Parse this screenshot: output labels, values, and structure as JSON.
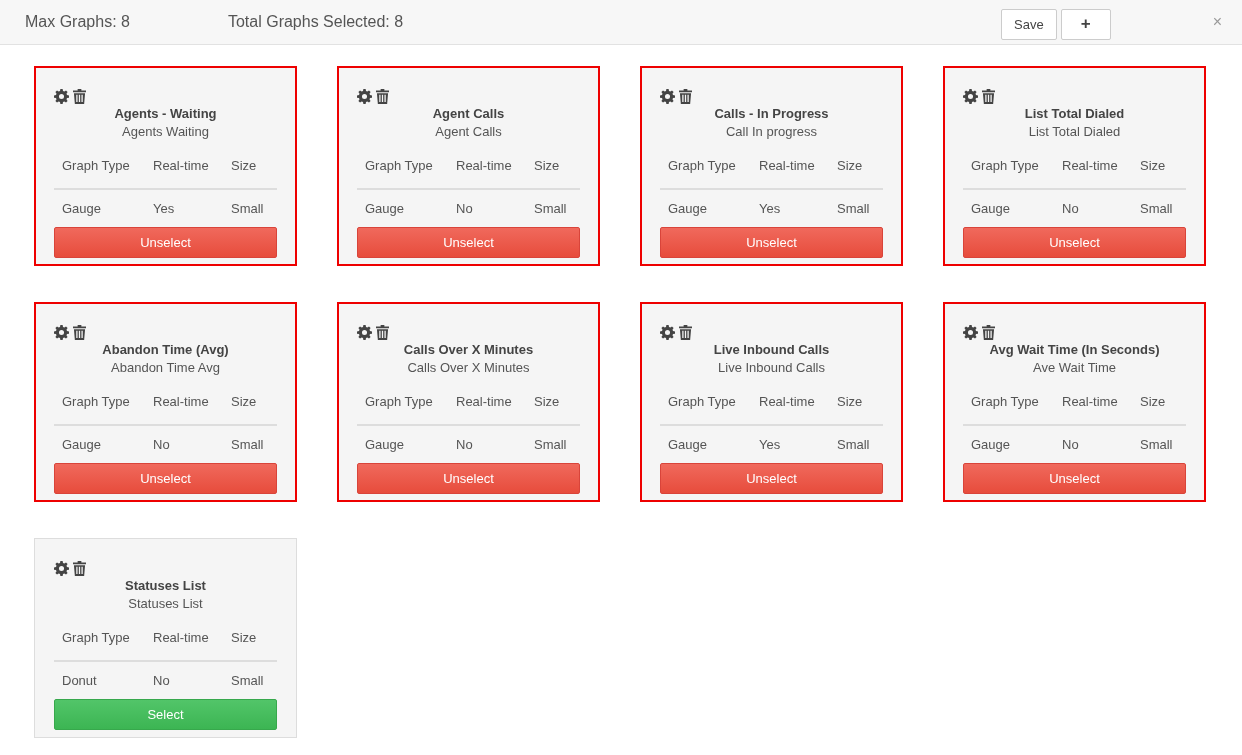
{
  "header": {
    "max_graphs": "Max Graphs: 8",
    "total_selected": "Total Graphs Selected: 8",
    "save_button": "Save",
    "add_button": "+",
    "close_button": "×"
  },
  "graphs": [
    {
      "title": "Agents - Waiting",
      "subtitle": "Agents Waiting",
      "columns": [
        "Graph Type",
        "Real-time",
        "Size"
      ],
      "values": [
        "Gauge",
        "Yes",
        "Small"
      ],
      "selected": true,
      "button": "Unselect"
    },
    {
      "title": "Agent Calls",
      "subtitle": "Agent Calls",
      "columns": [
        "Graph Type",
        "Real-time",
        "Size"
      ],
      "values": [
        "Gauge",
        "No",
        "Small"
      ],
      "selected": true,
      "button": "Unselect"
    },
    {
      "title": "Calls - In Progress",
      "subtitle": "Call In progress",
      "columns": [
        "Graph Type",
        "Real-time",
        "Size"
      ],
      "values": [
        "Gauge",
        "Yes",
        "Small"
      ],
      "selected": true,
      "button": "Unselect"
    },
    {
      "title": "List Total Dialed",
      "subtitle": "List Total Dialed",
      "columns": [
        "Graph Type",
        "Real-time",
        "Size"
      ],
      "values": [
        "Gauge",
        "No",
        "Small"
      ],
      "selected": true,
      "button": "Unselect"
    },
    {
      "title": "Abandon Time (Avg)",
      "subtitle": "Abandon Time Avg",
      "columns": [
        "Graph Type",
        "Real-time",
        "Size"
      ],
      "values": [
        "Gauge",
        "No",
        "Small"
      ],
      "selected": true,
      "button": "Unselect"
    },
    {
      "title": "Calls Over X Minutes",
      "subtitle": "Calls Over X Minutes",
      "columns": [
        "Graph Type",
        "Real-time",
        "Size"
      ],
      "values": [
        "Gauge",
        "No",
        "Small"
      ],
      "selected": true,
      "button": "Unselect"
    },
    {
      "title": "Live Inbound Calls",
      "subtitle": "Live Inbound Calls",
      "columns": [
        "Graph Type",
        "Real-time",
        "Size"
      ],
      "values": [
        "Gauge",
        "Yes",
        "Small"
      ],
      "selected": true,
      "button": "Unselect"
    },
    {
      "title": "Avg Wait Time (In Seconds)",
      "subtitle": "Ave Wait Time",
      "columns": [
        "Graph Type",
        "Real-time",
        "Size"
      ],
      "values": [
        "Gauge",
        "No",
        "Small"
      ],
      "selected": true,
      "button": "Unselect"
    },
    {
      "title": "Statuses List",
      "subtitle": "Statuses List",
      "columns": [
        "Graph Type",
        "Real-time",
        "Size"
      ],
      "values": [
        "Donut",
        "No",
        "Small"
      ],
      "selected": false,
      "button": "Select"
    }
  ]
}
